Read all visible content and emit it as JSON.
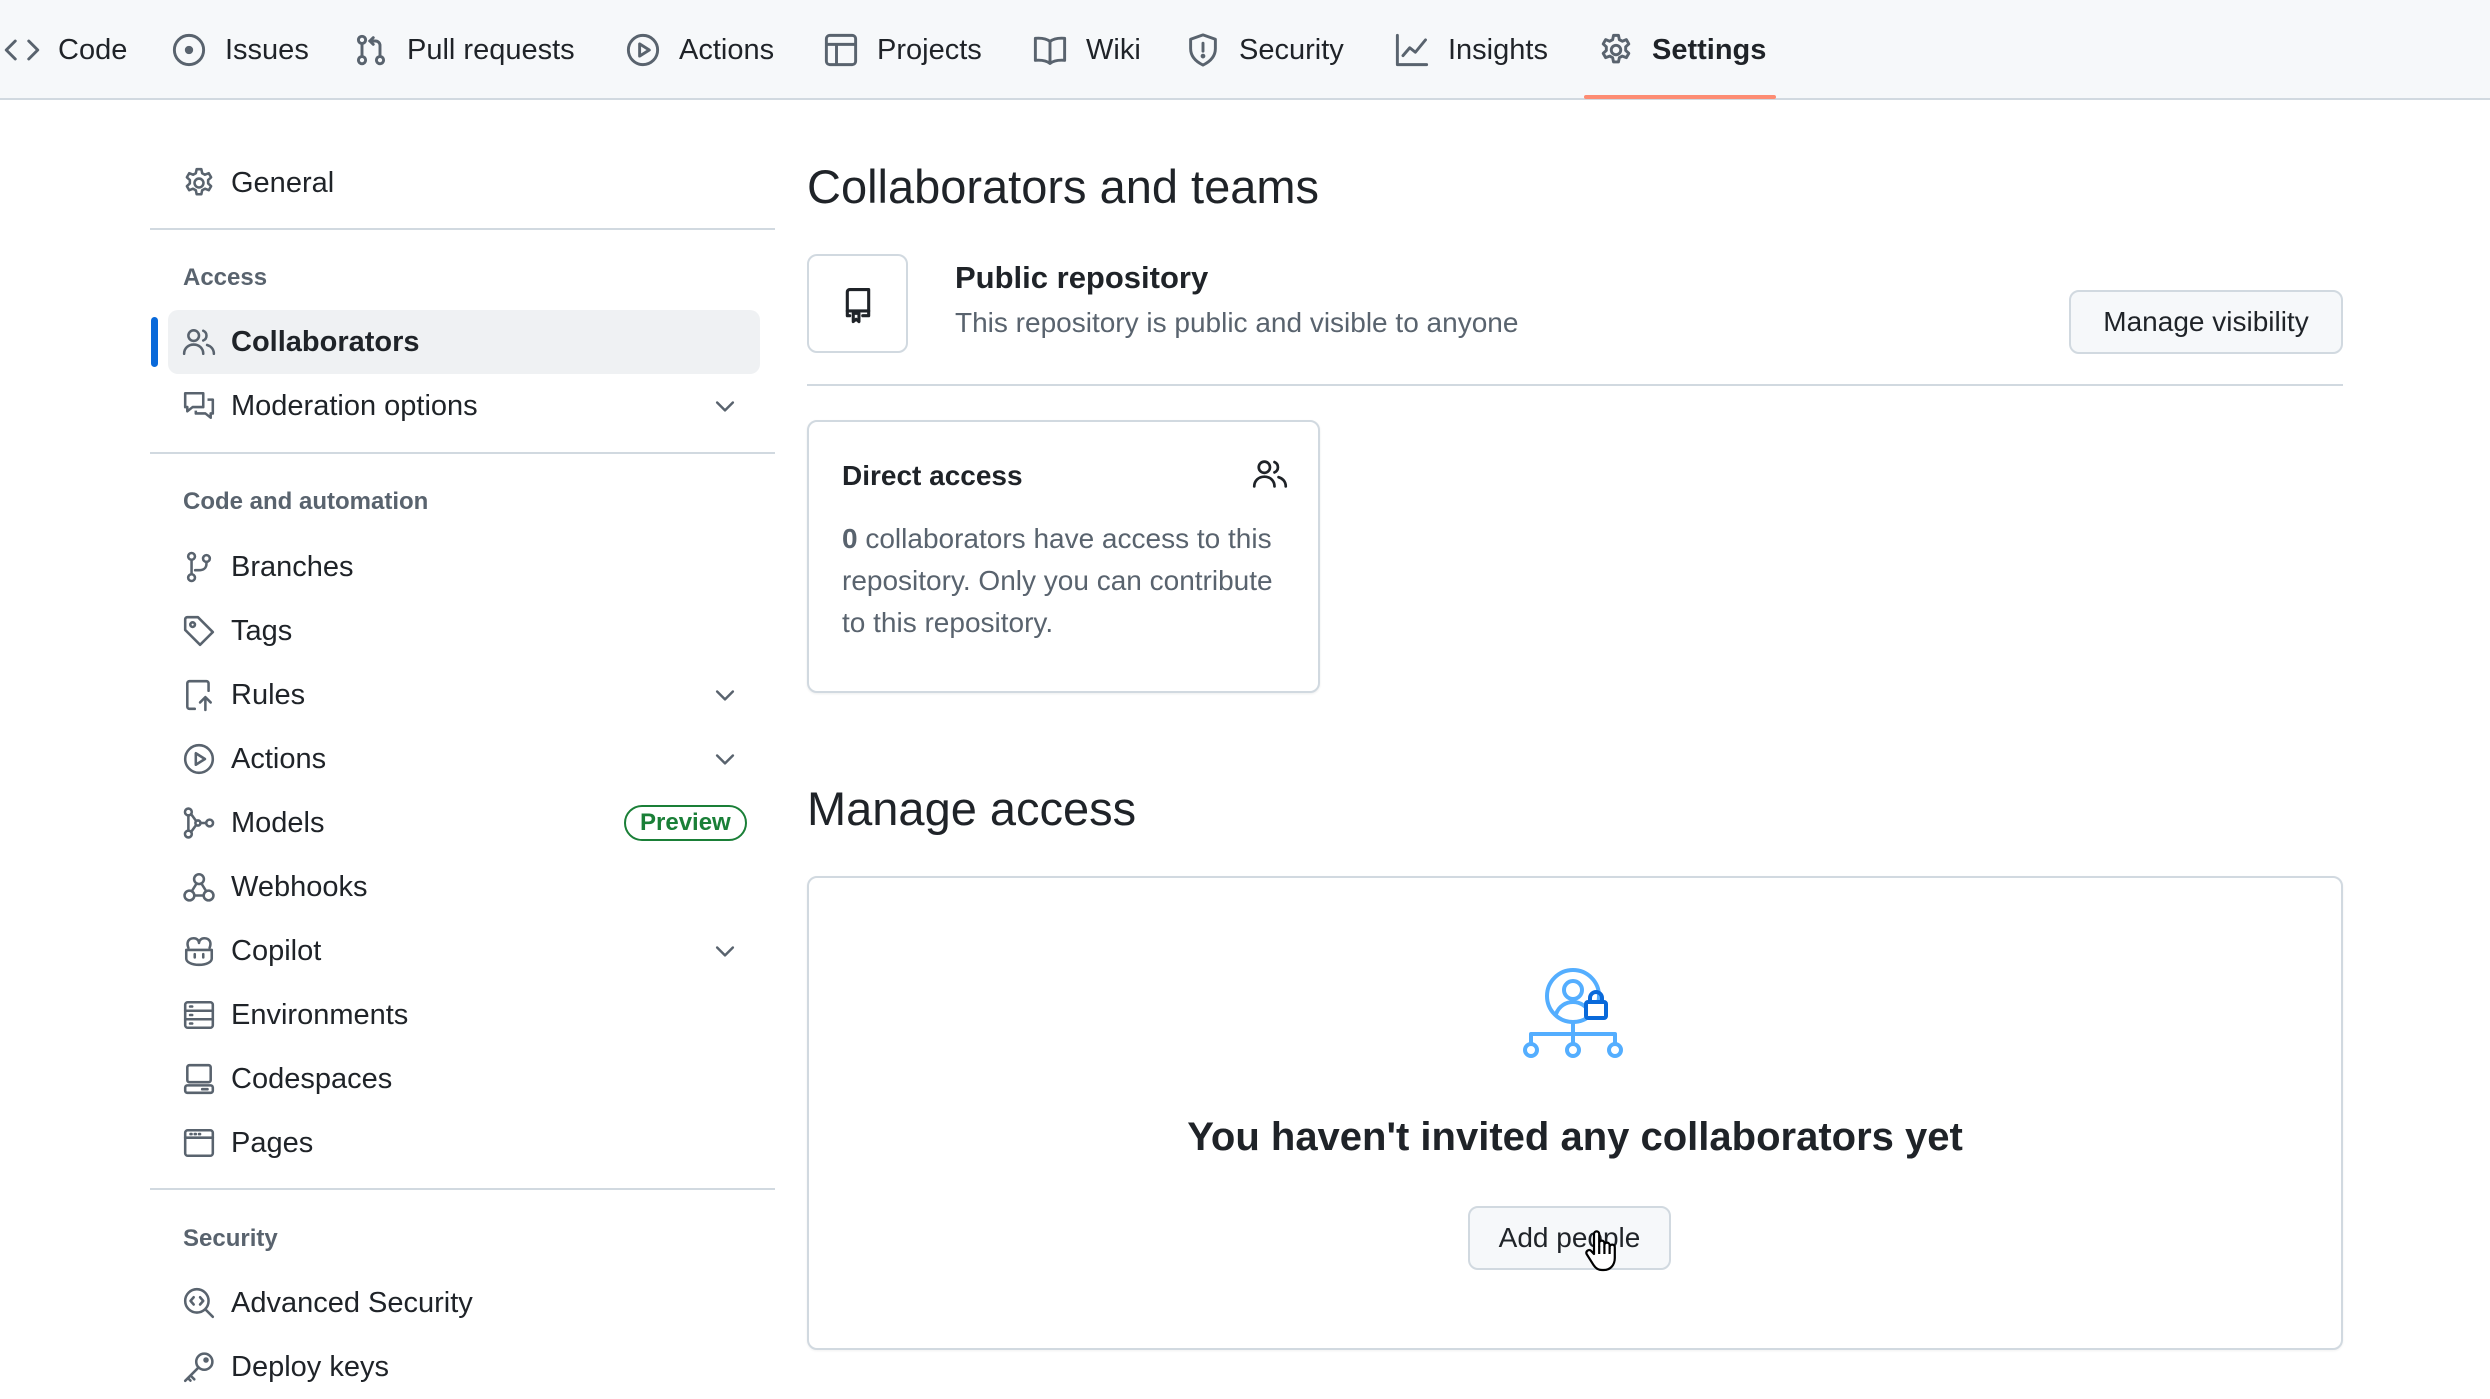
{
  "topnav": {
    "tabs": [
      {
        "label": "Code",
        "icon": "code-icon"
      },
      {
        "label": "Issues",
        "icon": "issue-opened-icon"
      },
      {
        "label": "Pull requests",
        "icon": "git-pull-request-icon"
      },
      {
        "label": "Actions",
        "icon": "play-icon"
      },
      {
        "label": "Projects",
        "icon": "table-icon"
      },
      {
        "label": "Wiki",
        "icon": "book-icon"
      },
      {
        "label": "Security",
        "icon": "shield-icon"
      },
      {
        "label": "Insights",
        "icon": "graph-icon"
      },
      {
        "label": "Settings",
        "icon": "gear-icon",
        "active": true
      }
    ]
  },
  "sidebar": {
    "general": "General",
    "sections": [
      {
        "heading": "Access",
        "items": [
          {
            "label": "Collaborators",
            "icon": "people-icon",
            "active": true
          },
          {
            "label": "Moderation options",
            "icon": "comment-discussion-icon",
            "expandable": true
          }
        ]
      },
      {
        "heading": "Code and automation",
        "items": [
          {
            "label": "Branches",
            "icon": "git-branch-icon"
          },
          {
            "label": "Tags",
            "icon": "tag-icon"
          },
          {
            "label": "Rules",
            "icon": "repo-push-icon",
            "expandable": true
          },
          {
            "label": "Actions",
            "icon": "play-icon",
            "expandable": true
          },
          {
            "label": "Models",
            "icon": "ai-model-icon",
            "badge": "Preview"
          },
          {
            "label": "Webhooks",
            "icon": "webhook-icon"
          },
          {
            "label": "Copilot",
            "icon": "copilot-icon",
            "expandable": true
          },
          {
            "label": "Environments",
            "icon": "server-icon"
          },
          {
            "label": "Codespaces",
            "icon": "codespaces-icon"
          },
          {
            "label": "Pages",
            "icon": "browser-icon"
          }
        ]
      },
      {
        "heading": "Security",
        "items": [
          {
            "label": "Advanced Security",
            "icon": "codescan-icon"
          },
          {
            "label": "Deploy keys",
            "icon": "key-icon"
          }
        ]
      }
    ]
  },
  "main": {
    "title": "Collaborators and teams",
    "visibility": {
      "title": "Public repository",
      "description": "This repository is public and visible to anyone",
      "button": "Manage visibility"
    },
    "direct_access": {
      "title": "Direct access",
      "count": "0",
      "text": " collaborators have access to this repository. Only you can contribute to this repository."
    },
    "manage_access": {
      "title": "Manage access",
      "empty_message": "You haven't invited any collaborators yet",
      "button": "Add people"
    }
  },
  "colors": {
    "accent": "#0969da",
    "tab_underline": "#fd8c73",
    "badge_green": "#1a7f37",
    "illustration_blue": "#54aeff"
  }
}
